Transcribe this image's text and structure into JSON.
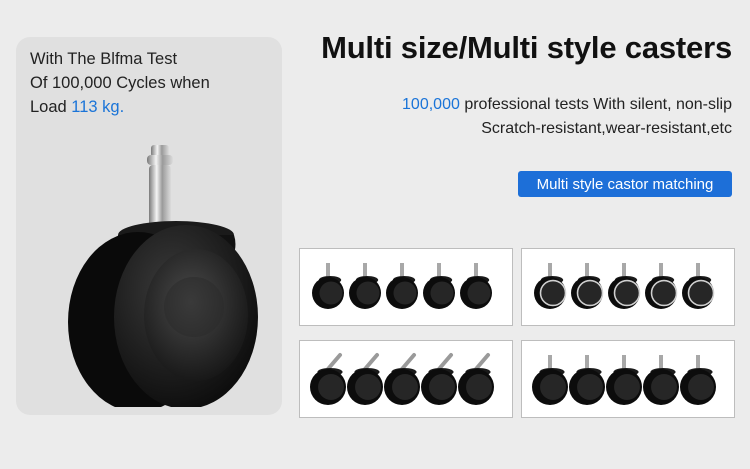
{
  "left_card": {
    "line1": "With The Blfma Test",
    "line2": "Of 100,000 Cycles when",
    "line3_prefix": "Load ",
    "line3_load": "113 kg",
    "line3_suffix": "."
  },
  "title": "Multi size/Multi style casters",
  "subtitle": {
    "count": "100,000",
    "line1_rest": " professional tests With silent, non-slip",
    "line2": "Scratch-resistant,wear-resistant,etc"
  },
  "badge": "Multi style castor matching",
  "colors": {
    "accent": "#1d6fd8",
    "highlight_text": "#1a74d8",
    "background": "#ececec",
    "card": "#e0e0e0"
  },
  "panels": [
    {
      "style": "plain-round"
    },
    {
      "style": "chrome-rim"
    },
    {
      "style": "angled-stem"
    },
    {
      "style": "straight-stem"
    }
  ]
}
